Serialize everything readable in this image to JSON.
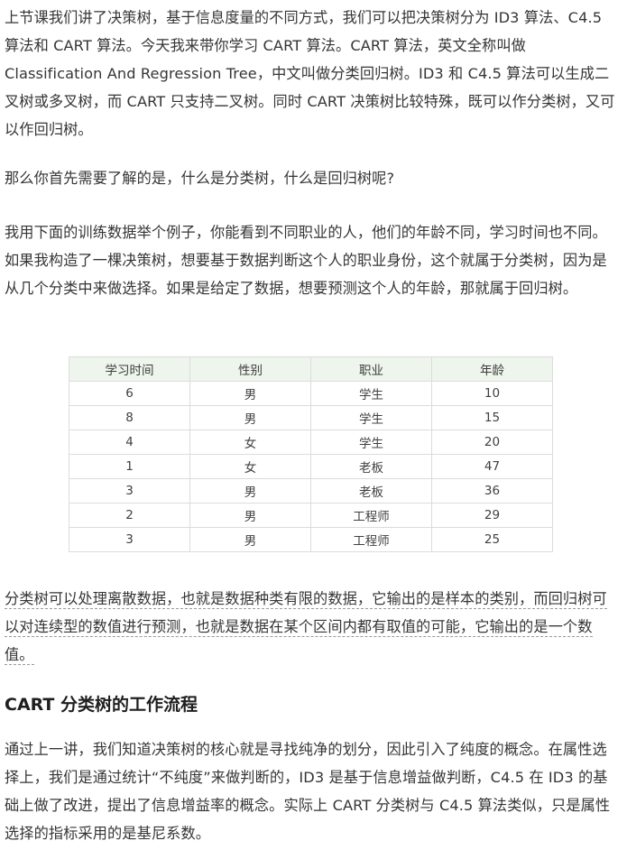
{
  "article": {
    "p1": "上节课我们讲了决策树，基于信息度量的不同方式，我们可以把决策树分为 ID3 算法、C4.5 算法和 CART 算法。今天我来带你学习 CART 算法。CART 算法，英文全称叫做 Classification And Regression Tree，中文叫做分类回归树。ID3 和 C4.5 算法可以生成二叉树或多叉树，而 CART 只支持二叉树。同时 CART 决策树比较特殊，既可以作分类树，又可以作回归树。",
    "p2": "那么你首先需要了解的是，什么是分类树，什么是回归树呢?",
    "p3": "我用下面的训练数据举个例子，你能看到不同职业的人，他们的年龄不同，学习时间也不同。如果我构造了一棵决策树，想要基于数据判断这个人的职业身份，这个就属于分类树，因为是从几个分类中来做选择。如果是给定了数据，想要预测这个人的年龄，那就属于回归树。",
    "p4": "分类树可以处理离散数据，也就是数据种类有限的数据，它输出的是样本的类别，而回归树可以对连续型的数值进行预测，也就是数据在某个区间内都有取值的可能，它输出的是一个数值。",
    "heading": "CART 分类树的工作流程",
    "p5": "通过上一讲，我们知道决策树的核心就是寻找纯净的划分，因此引入了纯度的概念。在属性选择上，我们是通过统计“不纯度”来做判断的，ID3 是基于信息增益做判断，C4.5 在 ID3 的基础上做了改进，提出了信息增益率的概念。实际上 CART 分类树与 C4.5 算法类似，只是属性选择的指标采用的是基尼系数。"
  },
  "table": {
    "headers": [
      "学习时间",
      "性别",
      "职业",
      "年龄"
    ],
    "rows": [
      [
        "6",
        "男",
        "学生",
        "10"
      ],
      [
        "8",
        "男",
        "学生",
        "15"
      ],
      [
        "4",
        "女",
        "学生",
        "20"
      ],
      [
        "1",
        "女",
        "老板",
        "47"
      ],
      [
        "3",
        "男",
        "老板",
        "36"
      ],
      [
        "2",
        "男",
        "工程师",
        "29"
      ],
      [
        "3",
        "男",
        "工程师",
        "25"
      ]
    ]
  },
  "colors": {
    "table_header_bg": "#eef5ec",
    "text": "#353535"
  }
}
